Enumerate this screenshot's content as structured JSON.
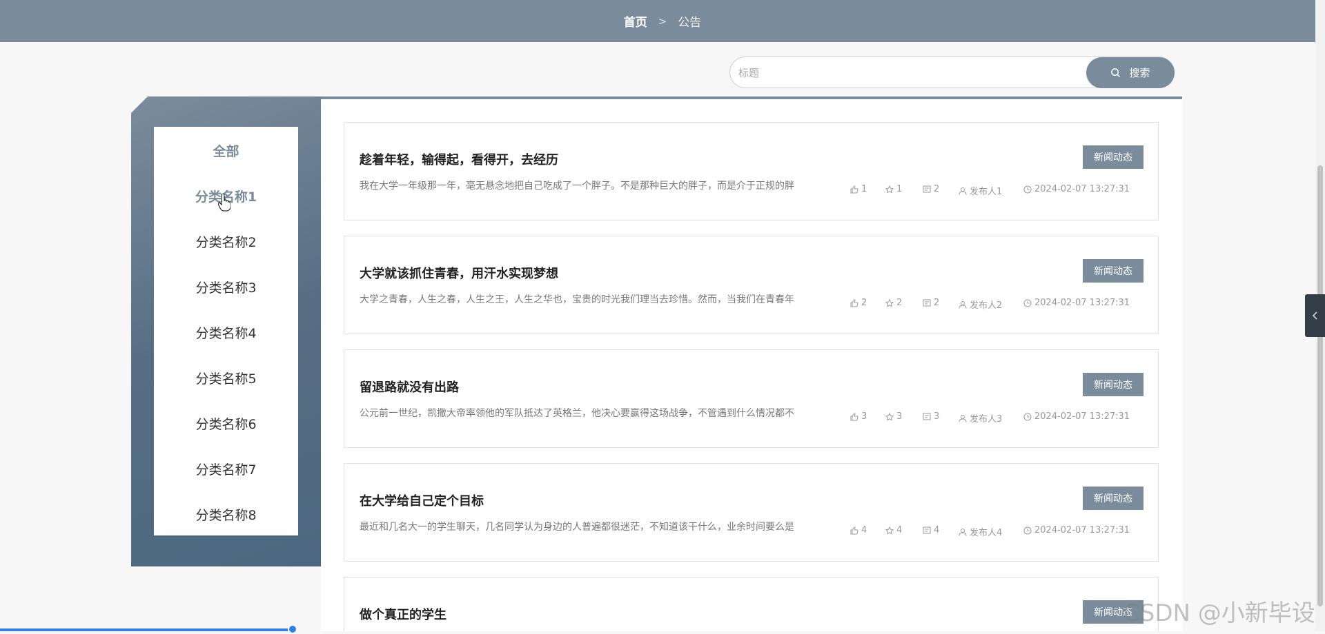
{
  "breadcrumb": {
    "home": "首页",
    "separator": ">",
    "current": "公告"
  },
  "search": {
    "placeholder": "标题",
    "button": "搜索"
  },
  "categories": [
    {
      "label": "全部"
    },
    {
      "label": "分类名称1"
    },
    {
      "label": "分类名称2"
    },
    {
      "label": "分类名称3"
    },
    {
      "label": "分类名称4"
    },
    {
      "label": "分类名称5"
    },
    {
      "label": "分类名称6"
    },
    {
      "label": "分类名称7"
    },
    {
      "label": "分类名称8"
    }
  ],
  "articles": [
    {
      "title": "趁着年轻，输得起，看得开，去经历",
      "excerpt": "我在大学一年级那一年，毫无悬念地把自己吃成了一个胖子。不是那种巨大的胖子，而是介于正规的胖",
      "tag": "新闻动态",
      "likes": "1",
      "favorites": "1",
      "comments": "2",
      "author": "发布人1",
      "time": "2024-02-07 13:27:31"
    },
    {
      "title": "大学就该抓住青春，用汗水实现梦想",
      "excerpt": "大学之青春，人生之春，人生之王，人生之华也，宝贵的时光我们理当去珍惜。然而，当我们在青春年",
      "tag": "新闻动态",
      "likes": "2",
      "favorites": "2",
      "comments": "2",
      "author": "发布人2",
      "time": "2024-02-07 13:27:31"
    },
    {
      "title": "留退路就没有出路",
      "excerpt": "公元前一世纪，凯撒大帝率领他的军队抵达了英格兰，他决心要赢得这场战争，不管遇到什么情况都不",
      "tag": "新闻动态",
      "likes": "3",
      "favorites": "3",
      "comments": "3",
      "author": "发布人3",
      "time": "2024-02-07 13:27:31"
    },
    {
      "title": "在大学给自己定个目标",
      "excerpt": "最近和几名大一的学生聊天，几名同学认为身边的人普遍都很迷茫，不知道该干什么，业余时间要么是",
      "tag": "新闻动态",
      "likes": "4",
      "favorites": "4",
      "comments": "4",
      "author": "发布人4",
      "time": "2024-02-07 13:27:31"
    },
    {
      "title": "做个真正的学生",
      "tag": "新闻动态"
    }
  ],
  "watermark": "CSDN @小新毕设",
  "colors": {
    "primary": "#7a8c9c",
    "panel_dark": "#4c6880"
  }
}
